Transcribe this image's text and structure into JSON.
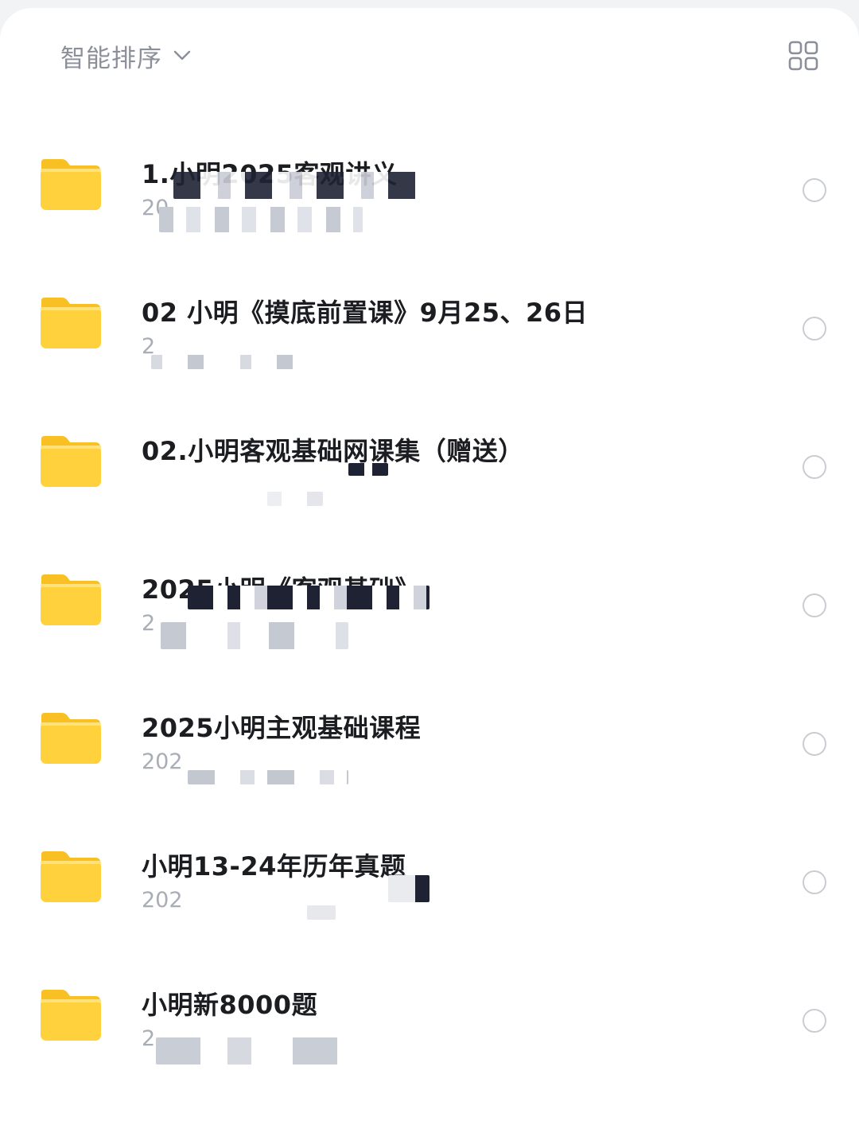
{
  "toolbar": {
    "sort_label": "智能排序",
    "sort_icon": "chevron-down-icon",
    "view_icon": "grid-view-icon"
  },
  "colors": {
    "folder": "#ffd23d",
    "folder_tab": "#f8c022",
    "title_text": "#1b1d21",
    "meta_text": "#a9adb5",
    "sort_text": "#8a8f99",
    "radio_border": "#c9ccd1"
  },
  "folders": [
    {
      "title": "1.小明2025客观讲义",
      "meta": "20"
    },
    {
      "title": "02 小明《摸底前置课》9月25、26日",
      "meta": "2"
    },
    {
      "title": "02.小明客观基础网课集（赠送）",
      "meta": ""
    },
    {
      "title": "2025小明《客观基础》",
      "meta": "2"
    },
    {
      "title": "2025小明主观基础课程",
      "meta": "202"
    },
    {
      "title": "小明13-24年历年真题",
      "meta": "202"
    },
    {
      "title": "小明新8000题",
      "meta": "2"
    }
  ]
}
